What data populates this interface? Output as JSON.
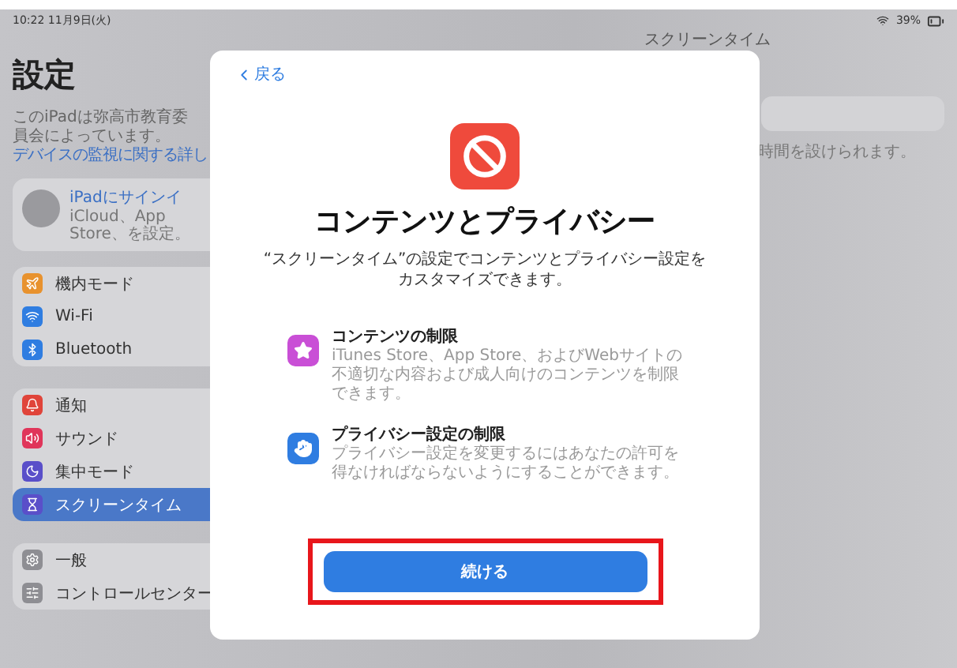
{
  "status_bar": {
    "time": "10:22",
    "date": "11月9日(火)",
    "battery": "39%"
  },
  "sidebar": {
    "title": "設定",
    "note": "このiPadは弥高市教育委員会によって",
    "note_cont": "います。",
    "note_link": "デバイスの監視に関する詳し",
    "account": {
      "title": "iPadにサインイ",
      "subtitle": "iCloud、App Store、",
      "subtitle_2": "を設定。"
    },
    "groups": [
      [
        {
          "label": "機内モード",
          "color": "#e8922e",
          "selected": false
        },
        {
          "label": "Wi-Fi",
          "color": "#2f7de1",
          "selected": false
        },
        {
          "label": "Bluetooth",
          "color": "#2f7de1",
          "selected": false
        }
      ],
      [
        {
          "label": "通知",
          "color": "#e0443a",
          "selected": false
        },
        {
          "label": "サウンド",
          "color": "#e0355a",
          "selected": false
        },
        {
          "label": "集中モード",
          "color": "#5a4fc9",
          "selected": false
        },
        {
          "label": "スクリーンタイム",
          "color": "#5a4fc9",
          "selected": true
        }
      ],
      [
        {
          "label": "一般",
          "color": "#8e8e93",
          "selected": false
        },
        {
          "label": "コントロールセンター",
          "color": "#8e8e93",
          "selected": false
        }
      ]
    ]
  },
  "detail": {
    "title": "スクリーンタイム",
    "hint": "時間を設けられます。"
  },
  "modal": {
    "back": "戻る",
    "title": "コンテンツとプライバシー",
    "description": "“スクリーンタイム”の設定でコンテンツとプライバシー設定をカスタマイズできます。",
    "features": [
      {
        "title": "コンテンツの制限",
        "text": "iTunes Store、App Store、およびWebサイトの不適切な内容および成人向けのコンテンツを制限できます。",
        "color": "#c94fd6"
      },
      {
        "title": "プライバシー設定の制限",
        "text": "プライバシー設定を変更するにはあなたの許可を得なければならないようにすることができます。",
        "color": "#2f7de1"
      }
    ],
    "button": {
      "label": "続ける",
      "highlighted": true
    }
  }
}
